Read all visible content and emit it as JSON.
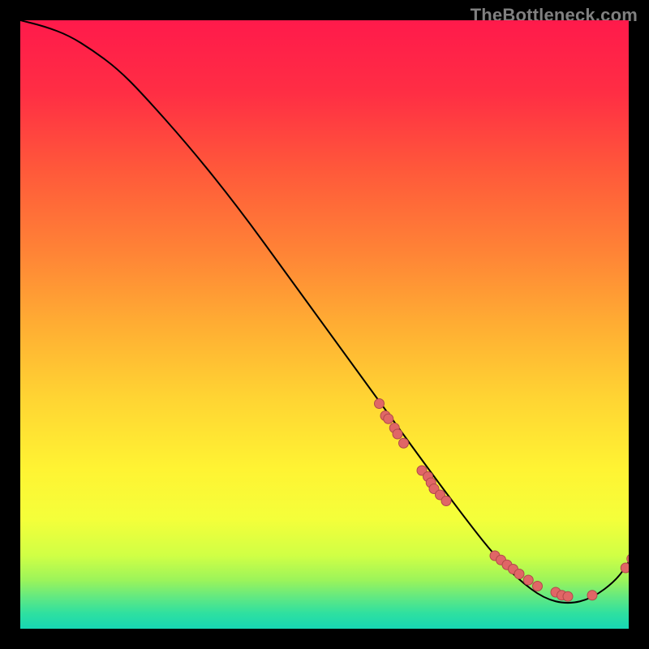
{
  "watermark": "TheBottleneck.com",
  "chart_data": {
    "type": "line",
    "title": "",
    "xlabel": "",
    "ylabel": "",
    "xlim": [
      0,
      100
    ],
    "ylim": [
      0,
      100
    ],
    "grid": false,
    "legend": false,
    "curve": {
      "x": [
        0,
        4,
        8,
        12,
        16,
        20,
        28,
        36,
        44,
        52,
        60,
        68,
        74,
        78,
        82,
        86,
        90,
        94,
        98,
        100
      ],
      "y": [
        100,
        99,
        97.5,
        95,
        92,
        88,
        79,
        69,
        58,
        47,
        36,
        25,
        17,
        12,
        8,
        5,
        4,
        5,
        8,
        11
      ]
    },
    "points": [
      {
        "x": 59,
        "y": 37
      },
      {
        "x": 60,
        "y": 35
      },
      {
        "x": 60.5,
        "y": 34.5
      },
      {
        "x": 61.5,
        "y": 33
      },
      {
        "x": 62,
        "y": 32
      },
      {
        "x": 63,
        "y": 30.5
      },
      {
        "x": 66,
        "y": 26
      },
      {
        "x": 67,
        "y": 25
      },
      {
        "x": 67.5,
        "y": 24
      },
      {
        "x": 68,
        "y": 23
      },
      {
        "x": 69,
        "y": 22
      },
      {
        "x": 70,
        "y": 21
      },
      {
        "x": 78,
        "y": 12
      },
      {
        "x": 79,
        "y": 11.3
      },
      {
        "x": 80,
        "y": 10.5
      },
      {
        "x": 81,
        "y": 9.8
      },
      {
        "x": 82,
        "y": 9
      },
      {
        "x": 83.5,
        "y": 8
      },
      {
        "x": 85,
        "y": 7
      },
      {
        "x": 88,
        "y": 6
      },
      {
        "x": 89,
        "y": 5.5
      },
      {
        "x": 90,
        "y": 5.3
      },
      {
        "x": 94,
        "y": 5.5
      },
      {
        "x": 99.5,
        "y": 10
      },
      {
        "x": 100.5,
        "y": 11.5
      }
    ],
    "gradient_stops": [
      {
        "offset": 0.0,
        "color": "#ff1a4b"
      },
      {
        "offset": 0.12,
        "color": "#ff2e44"
      },
      {
        "offset": 0.25,
        "color": "#ff5a3a"
      },
      {
        "offset": 0.38,
        "color": "#ff8336"
      },
      {
        "offset": 0.5,
        "color": "#ffad33"
      },
      {
        "offset": 0.62,
        "color": "#ffd433"
      },
      {
        "offset": 0.74,
        "color": "#fff433"
      },
      {
        "offset": 0.82,
        "color": "#f4ff3a"
      },
      {
        "offset": 0.88,
        "color": "#d0ff45"
      },
      {
        "offset": 0.92,
        "color": "#9cf45a"
      },
      {
        "offset": 0.95,
        "color": "#5ee884"
      },
      {
        "offset": 0.975,
        "color": "#2ee0a0"
      },
      {
        "offset": 1.0,
        "color": "#17d7b4"
      }
    ],
    "style": {
      "curve_color": "#000000",
      "curve_width": 2,
      "point_fill": "#e06666",
      "point_stroke": "#b04a4a",
      "point_radius": 6
    }
  }
}
